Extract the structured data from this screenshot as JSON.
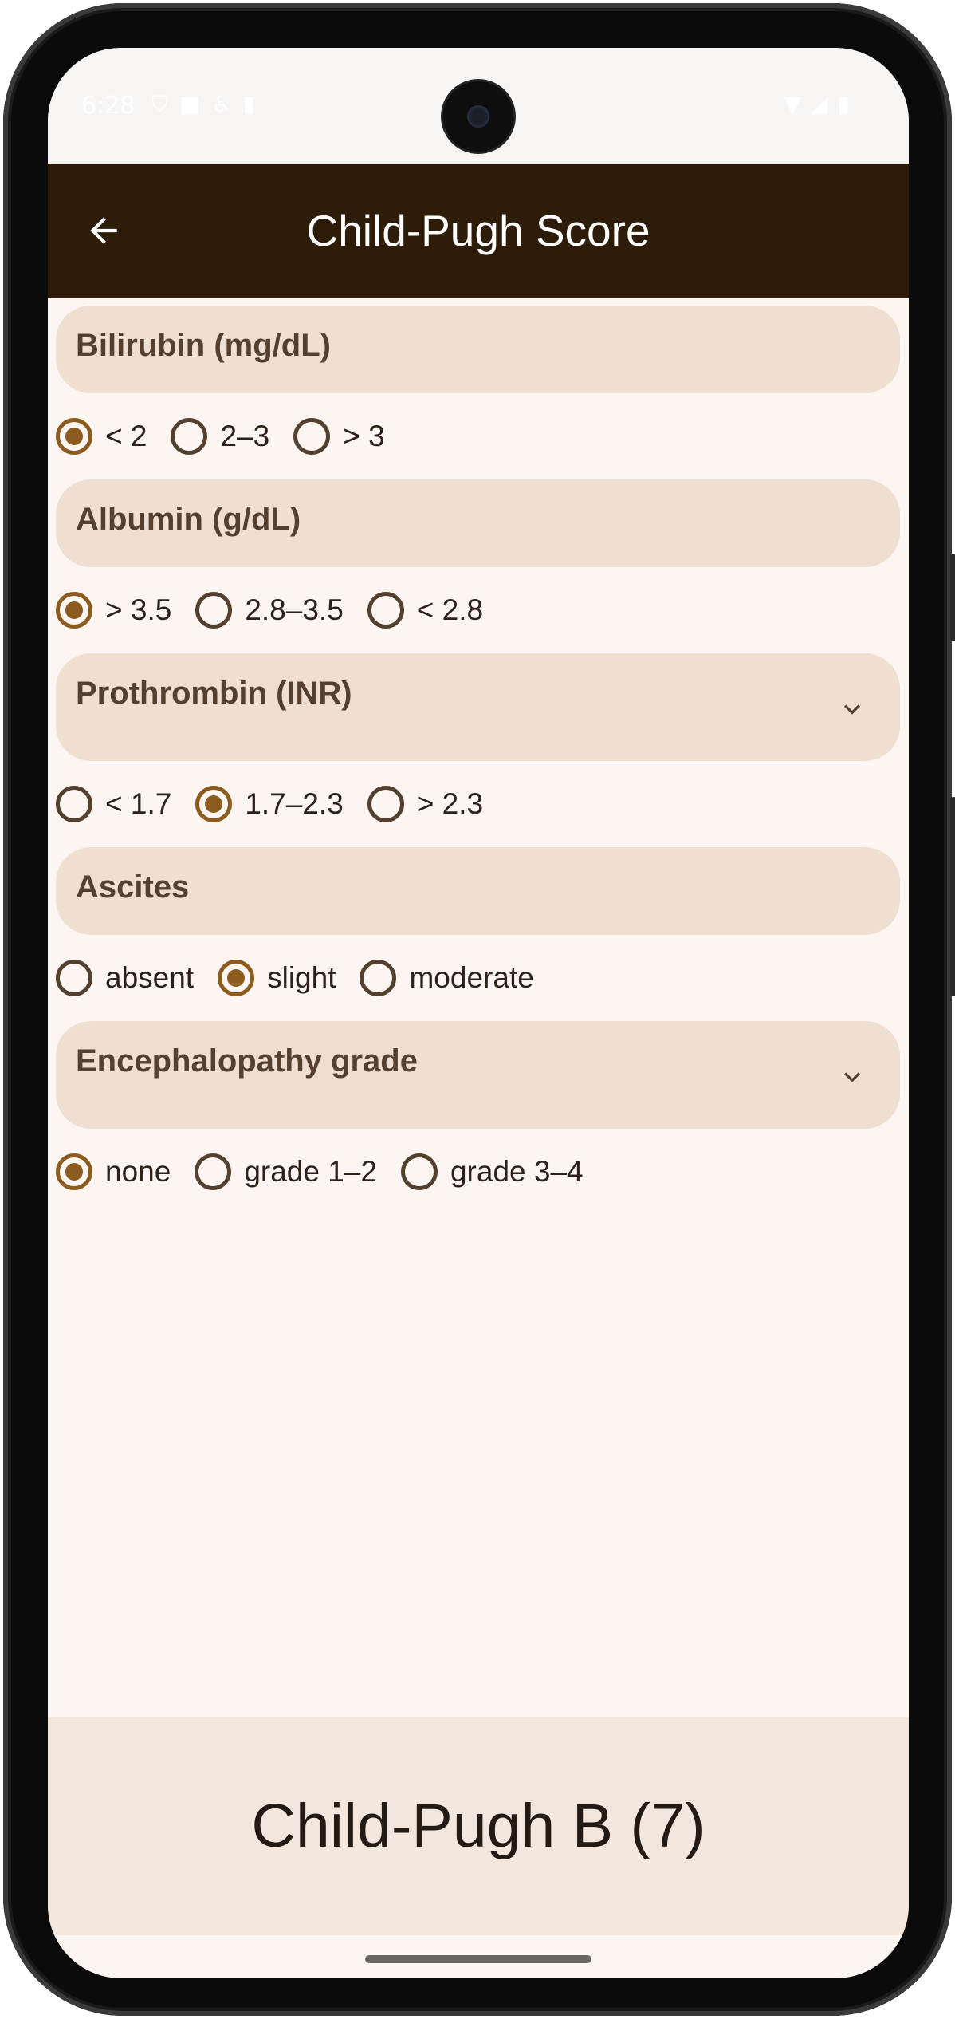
{
  "status_bar": {
    "time": "6:28",
    "icons_left": [
      "shield-icon",
      "square-icon",
      "accessibility-icon",
      "sd-card-icon"
    ],
    "icons_right": [
      "wifi-icon",
      "signal-icon",
      "battery-icon"
    ]
  },
  "app_bar": {
    "title": "Child-Pugh Score",
    "back_icon": "arrow-left-icon"
  },
  "sections": [
    {
      "label": "Bilirubin (mg/dL)",
      "has_chevron": false,
      "options": [
        "< 2",
        "2–3",
        "> 3"
      ],
      "selected": 0
    },
    {
      "label": "Albumin (g/dL)",
      "has_chevron": false,
      "options": [
        "> 3.5",
        "2.8–3.5",
        "< 2.8"
      ],
      "selected": 0
    },
    {
      "label": "Prothrombin (INR)",
      "has_chevron": true,
      "options": [
        "< 1.7",
        "1.7–2.3",
        "> 2.3"
      ],
      "selected": 1
    },
    {
      "label": "Ascites",
      "has_chevron": false,
      "options": [
        "absent",
        "slight",
        "moderate"
      ],
      "selected": 1
    },
    {
      "label": "Encephalopathy grade",
      "has_chevron": true,
      "options": [
        "none",
        "grade 1–2",
        "grade 3–4"
      ],
      "selected": 0
    }
  ],
  "result": {
    "text": "Child-Pugh B (7)"
  },
  "colors": {
    "app_bar": "#2d1c08",
    "section_header": "#efdfd0",
    "radio_selected": "#8b5c1e",
    "background": "#fcf5f2",
    "result_panel": "#f3e6dc"
  }
}
